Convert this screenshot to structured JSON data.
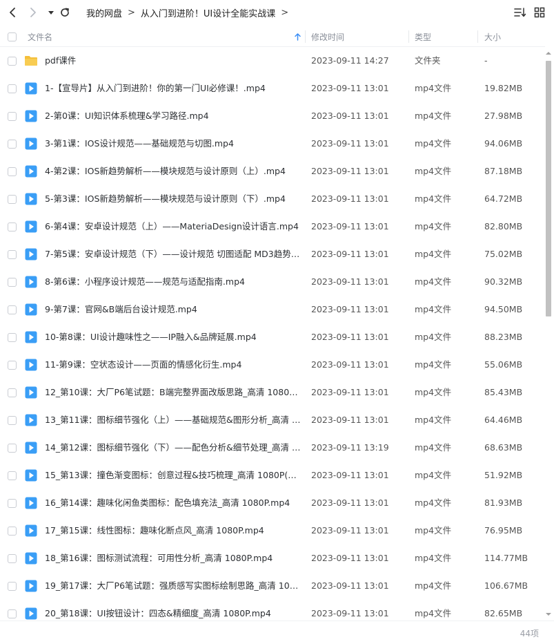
{
  "breadcrumb": [
    {
      "label": "我的网盘"
    },
    {
      "label": "从入门到进阶！UI设计全能实战课"
    }
  ],
  "columns": {
    "name": "文件名",
    "modified": "修改时间",
    "type": "类型",
    "size": "大小"
  },
  "files": [
    {
      "name": "pdf课件",
      "modified": "2023-09-11 14:27",
      "type": "文件夹",
      "size": "-",
      "icon": "folder-icon"
    },
    {
      "name": "1-【宣导片】从入门到进阶！你的第一门UI必修课！.mp4",
      "modified": "2023-09-11 13:01",
      "type": "mp4文件",
      "size": "19.82MB",
      "icon": "video-file-icon"
    },
    {
      "name": "2-第0课：UI知识体系梳理&学习路径.mp4",
      "modified": "2023-09-11 13:01",
      "type": "mp4文件",
      "size": "27.98MB",
      "icon": "video-file-icon"
    },
    {
      "name": "3-第1课：IOS设计规范——基础规范与切图.mp4",
      "modified": "2023-09-11 13:01",
      "type": "mp4文件",
      "size": "94.06MB",
      "icon": "video-file-icon"
    },
    {
      "name": "4-第2课：IOS新趋势解析——模块规范与设计原则（上）.mp4",
      "modified": "2023-09-11 13:01",
      "type": "mp4文件",
      "size": "87.18MB",
      "icon": "video-file-icon"
    },
    {
      "name": "5-第3课：IOS新趋势解析——模块规范与设计原则（下）.mp4",
      "modified": "2023-09-11 13:01",
      "type": "mp4文件",
      "size": "64.72MB",
      "icon": "video-file-icon"
    },
    {
      "name": "6-第4课：安卓设计规范（上）——MateriaDesign设计语言.mp4",
      "modified": "2023-09-11 13:01",
      "type": "mp4文件",
      "size": "82.80MB",
      "icon": "video-file-icon"
    },
    {
      "name": "7-第5课：安卓设计规范（下）——设计规范 切图适配 MD3趋势.m...",
      "modified": "2023-09-11 13:01",
      "type": "mp4文件",
      "size": "75.02MB",
      "icon": "video-file-icon"
    },
    {
      "name": "8-第6课：小程序设计规范——规范与适配指南.mp4",
      "modified": "2023-09-11 13:01",
      "type": "mp4文件",
      "size": "90.32MB",
      "icon": "video-file-icon"
    },
    {
      "name": "9-第7课：官网&B端后台设计规范.mp4",
      "modified": "2023-09-11 13:01",
      "type": "mp4文件",
      "size": "94.50MB",
      "icon": "video-file-icon"
    },
    {
      "name": "10-第8课：UI设计趣味性之——IP融入&品牌延展.mp4",
      "modified": "2023-09-11 13:01",
      "type": "mp4文件",
      "size": "88.23MB",
      "icon": "video-file-icon"
    },
    {
      "name": "11-第9课：空状态设计——页面的情感化衍生.mp4",
      "modified": "2023-09-11 13:01",
      "type": "mp4文件",
      "size": "55.06MB",
      "icon": "video-file-icon"
    },
    {
      "name": "12_第10课：大厂P6笔试题：B端完整界面改版思路_高清 1080P.mp4",
      "modified": "2023-09-11 13:01",
      "type": "mp4文件",
      "size": "85.43MB",
      "icon": "video-file-icon"
    },
    {
      "name": "13_第11课：图标细节强化（上）——基础规范&图形分析_高清 10...",
      "modified": "2023-09-11 13:01",
      "type": "mp4文件",
      "size": "64.46MB",
      "icon": "video-file-icon"
    },
    {
      "name": "14_第12课：图标细节强化（下）——配色分析&细节处理_高清 10...",
      "modified": "2023-09-11 13:19",
      "type": "mp4文件",
      "size": "68.63MB",
      "icon": "video-file-icon"
    },
    {
      "name": "15_第13课：撞色渐变图标：创意过程&技巧梳理_高清 1080P(1).m...",
      "modified": "2023-09-11 13:01",
      "type": "mp4文件",
      "size": "51.92MB",
      "icon": "video-file-icon"
    },
    {
      "name": "16_第14课：趣味化闲鱼类图标：配色填充法_高清 1080P.mp4",
      "modified": "2023-09-11 13:01",
      "type": "mp4文件",
      "size": "81.93MB",
      "icon": "video-file-icon"
    },
    {
      "name": "17_第15课：线性图标：趣味化断点风_高清 1080P.mp4",
      "modified": "2023-09-11 13:01",
      "type": "mp4文件",
      "size": "76.95MB",
      "icon": "video-file-icon"
    },
    {
      "name": "18_第16课：图标测试流程：可用性分析_高清 1080P.mp4",
      "modified": "2023-09-11 13:01",
      "type": "mp4文件",
      "size": "114.77MB",
      "icon": "video-file-icon"
    },
    {
      "name": "19_第17课：大厂P6笔试题：强质感写实图标绘制思路_高清 1080P....",
      "modified": "2023-09-11 13:01",
      "type": "mp4文件",
      "size": "106.67MB",
      "icon": "video-file-icon"
    },
    {
      "name": "20_第18课：UI按钮设计：四态&精细度_高清 1080P.mp4",
      "modified": "2023-09-11 13:01",
      "type": "mp4文件",
      "size": "82.65MB",
      "icon": "video-file-icon"
    }
  ],
  "footer": {
    "item_count": "44项"
  },
  "colors": {
    "video_icon": "#3a9ef6",
    "folder_icon": "#f5bf3a",
    "sort_arrow": "#3a8ef6"
  }
}
